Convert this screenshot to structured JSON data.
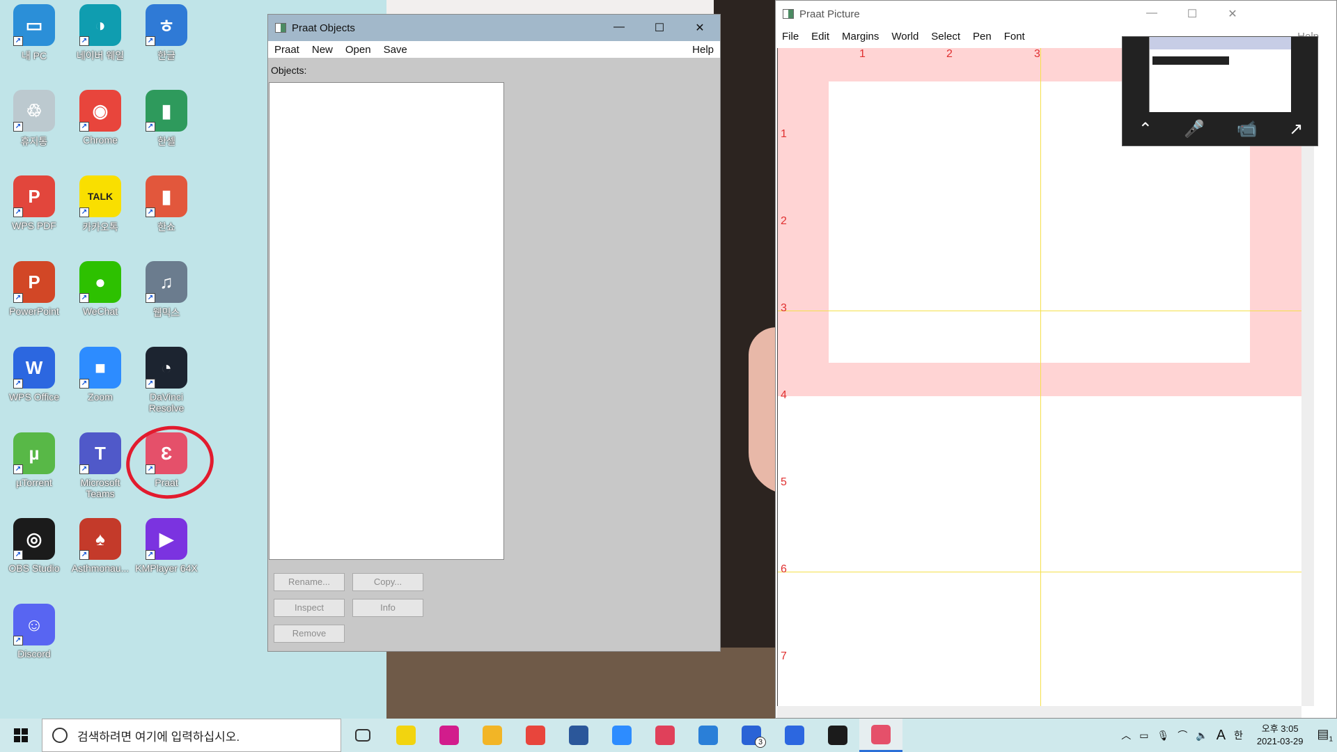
{
  "desktop": {
    "icons": [
      {
        "label": "내 PC",
        "color": "#2b8fd8",
        "glyph": "▭"
      },
      {
        "label": "네이버 웨일",
        "color": "#0f9db0",
        "glyph": "◑"
      },
      {
        "label": "한글",
        "color": "#2f7ad6",
        "glyph": "ㅎ"
      },
      {
        "label": "휴지통",
        "color": "#bcc9cf",
        "glyph": "♲"
      },
      {
        "label": "Chrome",
        "color": "#e8453c",
        "glyph": "◉"
      },
      {
        "label": "한셀",
        "color": "#2e9a5c",
        "glyph": "▮"
      },
      {
        "label": "WPS PDF",
        "color": "#e2463c",
        "glyph": "P"
      },
      {
        "label": "카카오톡",
        "color": "#f9df00",
        "glyph": "TALK"
      },
      {
        "label": "한쇼",
        "color": "#e2573c",
        "glyph": "▮"
      },
      {
        "label": "PowerPoint",
        "color": "#d24726",
        "glyph": "P"
      },
      {
        "label": "WeChat",
        "color": "#2dc100",
        "glyph": "●"
      },
      {
        "label": "웹믹스",
        "color": "#6b7c8e",
        "glyph": "♫"
      },
      {
        "label": "WPS Office",
        "color": "#2c67e0",
        "glyph": "W"
      },
      {
        "label": "Zoom",
        "color": "#2d8cff",
        "glyph": "■"
      },
      {
        "label": "DaVinci Resolve",
        "color": "#1c2430",
        "glyph": "◔"
      },
      {
        "label": "µTorrent",
        "color": "#58b847",
        "glyph": "µ"
      },
      {
        "label": "Microsoft Teams",
        "color": "#5059c9",
        "glyph": "T"
      },
      {
        "label": "Praat",
        "color": "#e5506a",
        "glyph": "Ɛ"
      },
      {
        "label": "OBS Studio",
        "color": "#1b1b1b",
        "glyph": "◎"
      },
      {
        "label": "Asthmonau...",
        "color": "#c43a2a",
        "glyph": "♠"
      },
      {
        "label": "KMPlayer 64X",
        "color": "#7b33e0",
        "glyph": "▶"
      },
      {
        "label": "Discord",
        "color": "#5865f2",
        "glyph": "☺"
      }
    ]
  },
  "praat_objects": {
    "title": "Praat Objects",
    "menu": [
      "Praat",
      "New",
      "Open",
      "Save"
    ],
    "help": "Help",
    "objects_label": "Objects:",
    "buttons": {
      "rename": "Rename...",
      "copy": "Copy...",
      "inspect": "Inspect",
      "info": "Info",
      "remove": "Remove"
    }
  },
  "praat_picture": {
    "title": "Praat Picture",
    "menu": [
      "File",
      "Edit",
      "Margins",
      "World",
      "Select",
      "Pen",
      "Font"
    ],
    "help": "Help",
    "top_ruler": [
      "1",
      "2",
      "3"
    ],
    "left_ruler": [
      "1",
      "2",
      "3",
      "4",
      "5",
      "6",
      "7"
    ]
  },
  "taskbar": {
    "search_placeholder": "검색하려면 여기에 입력하십시오.",
    "apps": [
      {
        "name": "task-view",
        "color": "#333"
      },
      {
        "name": "sticky-notes",
        "color": "#f2d40f"
      },
      {
        "name": "audio-app",
        "color": "#d21c8c"
      },
      {
        "name": "file-explorer",
        "color": "#f2b526"
      },
      {
        "name": "chrome",
        "color": "#e8453c"
      },
      {
        "name": "word",
        "color": "#2b579a"
      },
      {
        "name": "zoom",
        "color": "#2d8cff"
      },
      {
        "name": "snipping-tool",
        "color": "#e0405a"
      },
      {
        "name": "calendar",
        "color": "#2a7fd8"
      },
      {
        "name": "todo",
        "color": "#2a63d6"
      },
      {
        "name": "wps",
        "color": "#2c67e0"
      },
      {
        "name": "obs",
        "color": "#1b1b1b"
      },
      {
        "name": "praat",
        "color": "#e5506a"
      }
    ],
    "todo_badge": "3",
    "ime_letter": "A",
    "ime_lang": "한",
    "time": "오후 3:05",
    "date": "2021-03-29",
    "notif_count": "1"
  }
}
